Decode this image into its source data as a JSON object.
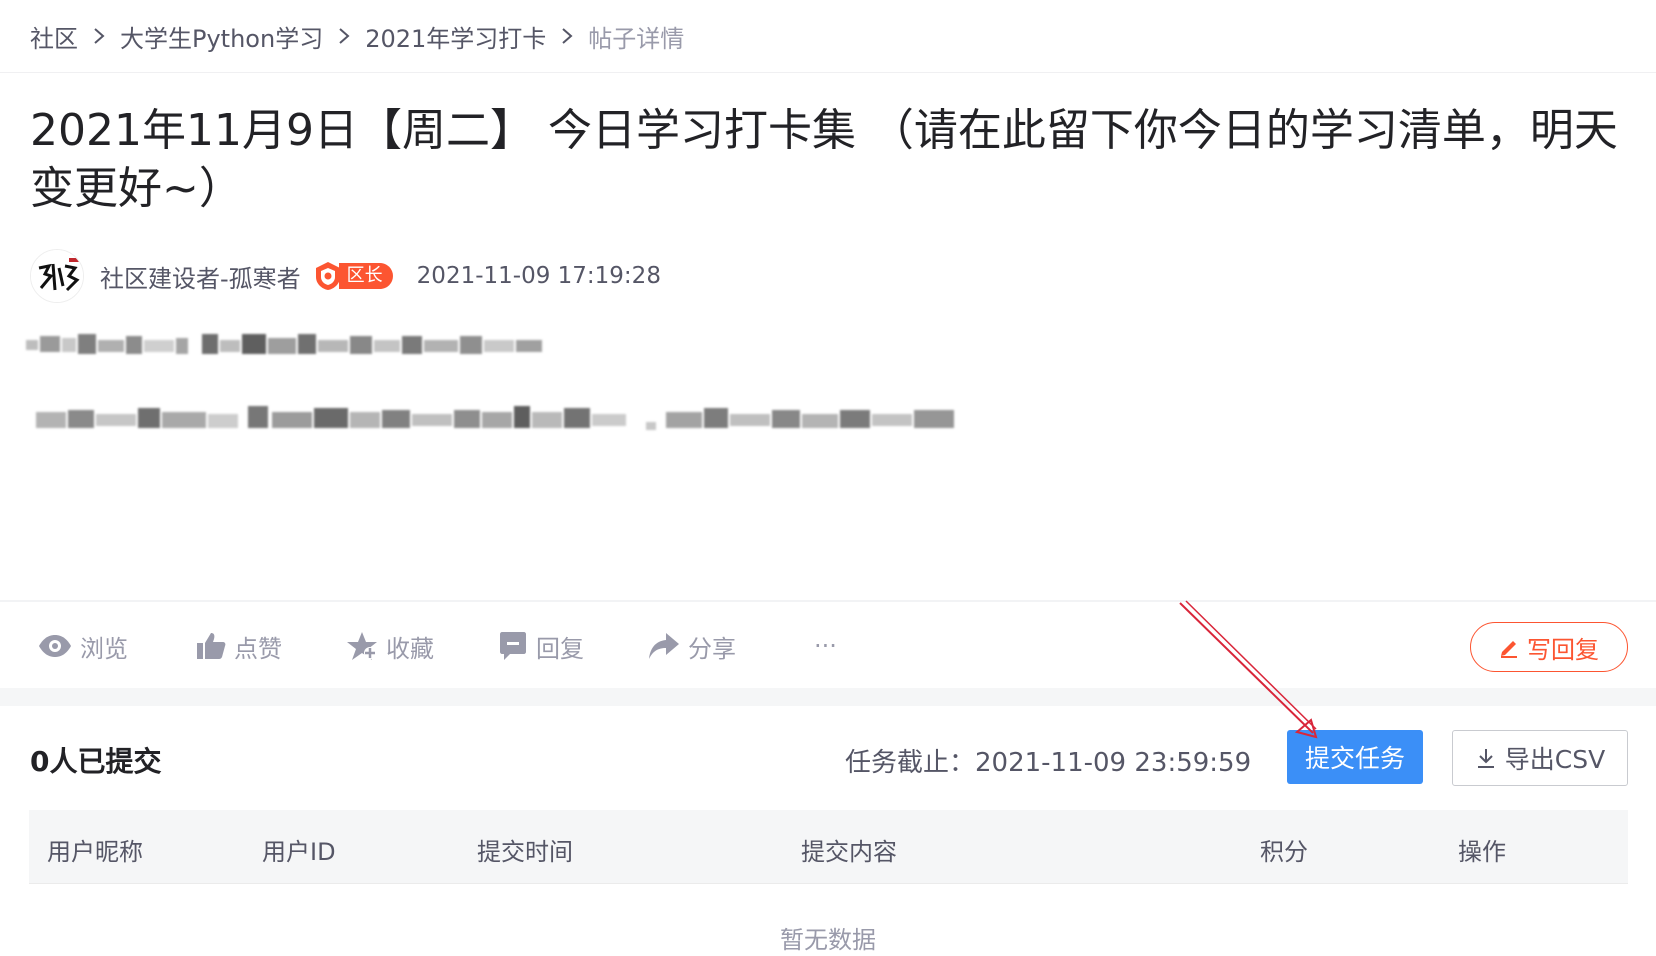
{
  "breadcrumb": {
    "items": [
      "社区",
      "大学生Python学习",
      "2021年学习打卡"
    ],
    "current": "帖子详情"
  },
  "post": {
    "title": "2021年11月9日【周二】 今日学习打卡集 （请在此留下你今日的学习清单，明天变更好~）",
    "author": "社区建设者-孤寒者",
    "badge": "区长",
    "time": "2021-11-09 17:19:28"
  },
  "actions": {
    "view": "浏览",
    "like": "点赞",
    "favorite": "收藏",
    "reply": "回复",
    "share": "分享",
    "more": "···",
    "write_reply": "写回复"
  },
  "task": {
    "submitted_count": "0人已提交",
    "deadline": "任务截止：2021-11-09 23:59:59",
    "submit_label": "提交任务",
    "export_label": "导出CSV"
  },
  "table": {
    "columns": [
      "用户昵称",
      "用户ID",
      "提交时间",
      "提交内容",
      "积分",
      "操作"
    ],
    "empty_text": "暂无数据"
  },
  "colors": {
    "accent_red": "#fc5531",
    "primary_blue": "#3b8ff7",
    "annotation_arrow": "#d9263a"
  }
}
